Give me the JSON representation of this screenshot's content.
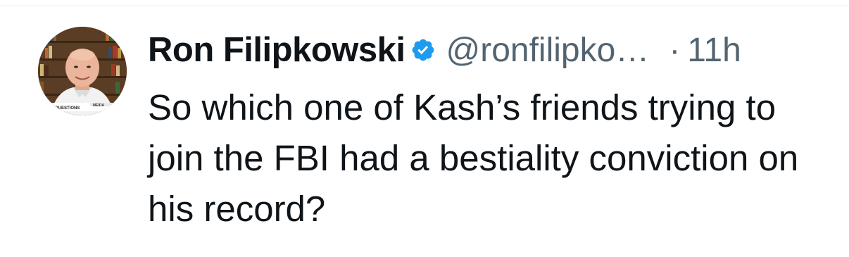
{
  "tweet": {
    "display_name": "Ron Filipkowski",
    "handle": "@ronfilipko…",
    "separator": "·",
    "timestamp": "11h",
    "verified": true,
    "text": "So which one of Kash’s friends trying to join the FBI had a bestiality conviction on his record?"
  },
  "colors": {
    "text_primary": "#0f1419",
    "text_secondary": "#536471",
    "verified_badge": "#1d9bf0",
    "divider": "#e6e9ec"
  },
  "icons": {
    "verified": "verified-badge-icon",
    "avatar": "profile-avatar"
  }
}
